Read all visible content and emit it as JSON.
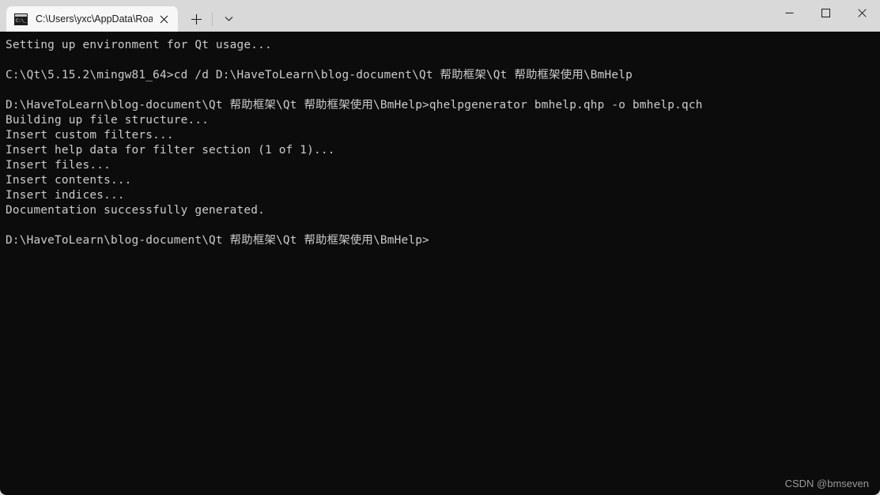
{
  "window": {
    "titlebar_color": "#d9d9d9",
    "tab": {
      "title": "C:\\Users\\yxc\\AppData\\Roamin",
      "icon_name": "cmd-console-icon",
      "icon_glyph": "C:\\_",
      "close_label": "Close tab"
    },
    "new_tab_label": "+",
    "tab_dropdown_label": "Open new tab dropdown",
    "controls": {
      "minimize_label": "Minimize",
      "maximize_label": "Maximize",
      "close_label": "Close"
    }
  },
  "terminal": {
    "background": "#0c0c0c",
    "foreground": "#cccccc",
    "lines": [
      "Setting up environment for Qt usage...",
      "",
      "C:\\Qt\\5.15.2\\mingw81_64>cd /d D:\\HaveToLearn\\blog-document\\Qt 帮助框架\\Qt 帮助框架使用\\BmHelp",
      "",
      "D:\\HaveToLearn\\blog-document\\Qt 帮助框架\\Qt 帮助框架使用\\BmHelp>qhelpgenerator bmhelp.qhp -o bmhelp.qch",
      "Building up file structure...",
      "Insert custom filters...",
      "Insert help data for filter section (1 of 1)...",
      "Insert files...",
      "Insert contents...",
      "Insert indices...",
      "Documentation successfully generated.",
      "",
      "D:\\HaveToLearn\\blog-document\\Qt 帮助框架\\Qt 帮助框架使用\\BmHelp>"
    ]
  },
  "watermark": {
    "text": "CSDN @bmseven"
  }
}
